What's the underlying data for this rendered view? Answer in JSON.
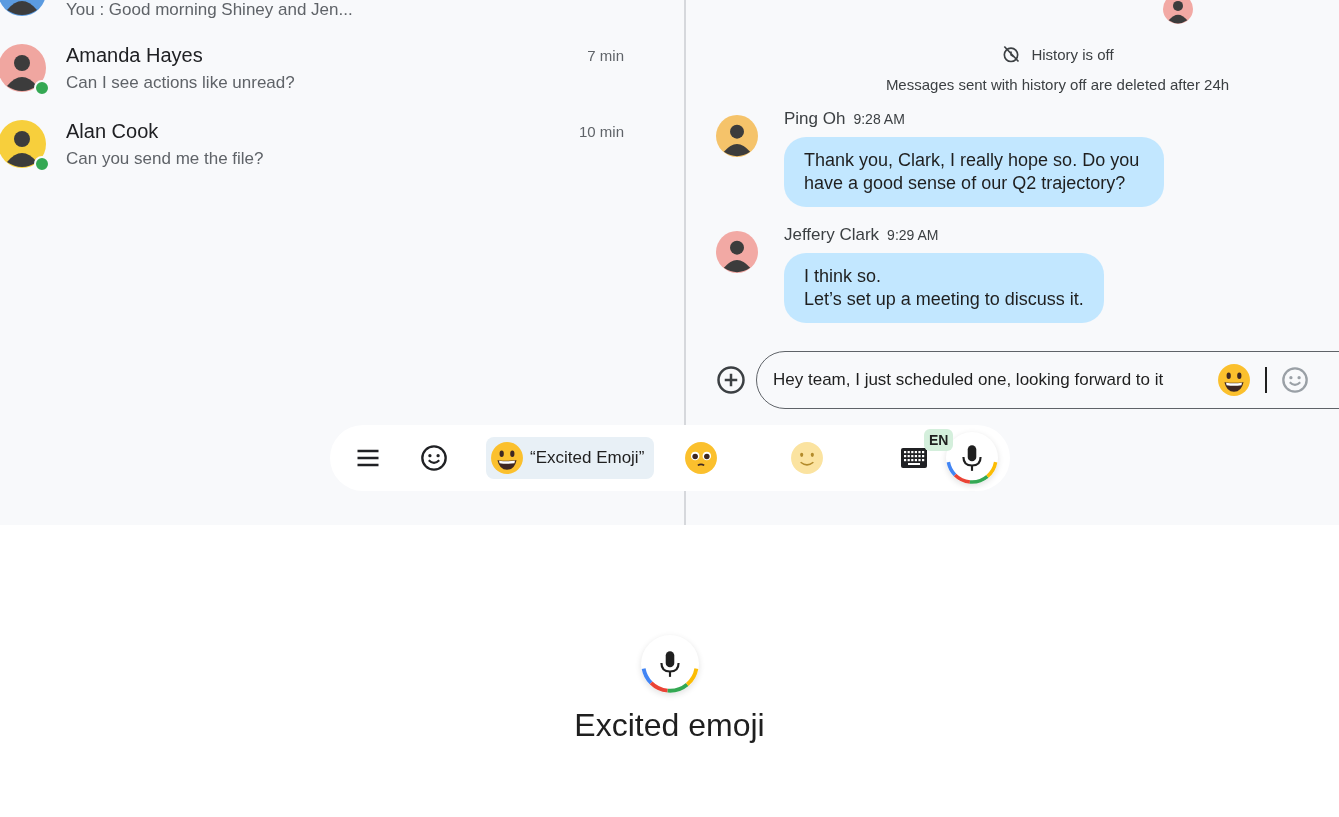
{
  "chats": [
    {
      "preview": "You : Good morning Shiney and Jen..."
    },
    {
      "name": "Amanda Hayes",
      "time": "7 min",
      "preview": "Can I see actions like unread?",
      "online": true
    },
    {
      "name": "Alan Cook",
      "time": "10 min",
      "preview": "Can you send me the file?",
      "online": true
    }
  ],
  "history_notice": {
    "title": "History is off",
    "detail": "Messages sent with history off are deleted after 24h"
  },
  "messages": [
    {
      "sender": "Ping Oh",
      "time": "9:28 AM",
      "lines": [
        "Thank you, Clark, I really hope so. Do you have a good sense of our Q2 trajectory?"
      ]
    },
    {
      "sender": "Jeffery Clark",
      "time": "9:29 AM",
      "lines": [
        "I think so.",
        "Let’s set up a meeting to discuss it."
      ]
    }
  ],
  "composer": {
    "value": "Hey team, I just scheduled one, looking forward to it"
  },
  "keyboard_toolbar": {
    "suggestions": [
      {
        "kind": "phrase",
        "label": "“Excited Emoji”",
        "selected": true
      },
      {
        "kind": "pleading",
        "selected": false
      },
      {
        "kind": "smile",
        "selected": false
      }
    ],
    "language": "EN"
  },
  "voice": {
    "transcript": "Excited emoji"
  }
}
